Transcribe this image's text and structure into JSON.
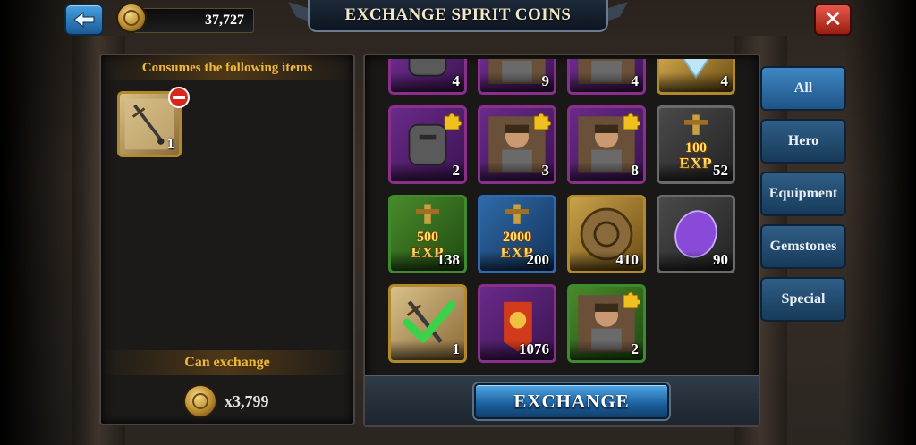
{
  "header": {
    "title": "EXCHANGE SPIRIT COINS",
    "coin_balance": "37,727"
  },
  "left_panel": {
    "consume_title": "Consumes the following items",
    "consume_item": {
      "icon": "sword-scroll-icon",
      "count": "1"
    },
    "can_exchange_label": "Can exchange",
    "can_exchange_amount": "x3,799"
  },
  "grid": {
    "rows": [
      [
        {
          "icon": "armor-fragment-icon",
          "count": "4",
          "frame": "purple"
        },
        {
          "icon": "hero-fragment-icon",
          "count": "9",
          "frame": "purple"
        },
        {
          "icon": "hero-fragment-icon",
          "count": "4",
          "frame": "purple"
        },
        {
          "icon": "diamond-icon",
          "count": "4",
          "frame": "gold"
        }
      ],
      [
        {
          "icon": "armor-fragment-icon",
          "count": "2",
          "frame": "purple"
        },
        {
          "icon": "hero-fragment-icon",
          "count": "3",
          "frame": "purple"
        },
        {
          "icon": "hero-fragment-icon",
          "count": "8",
          "frame": "purple"
        },
        {
          "icon": "exp-scroll-icon",
          "count": "52",
          "frame": "gray",
          "exp": "100",
          "exp_text": "EXP"
        }
      ],
      [
        {
          "icon": "exp-scroll-icon",
          "count": "138",
          "frame": "green",
          "exp": "500",
          "exp_text": "EXP"
        },
        {
          "icon": "exp-scroll-icon",
          "count": "200",
          "frame": "blue",
          "exp": "2000",
          "exp_text": "EXP"
        },
        {
          "icon": "shield-medallion-icon",
          "count": "410",
          "frame": "gold"
        },
        {
          "icon": "purple-gem-icon",
          "count": "90",
          "frame": "gray"
        }
      ],
      [
        {
          "icon": "sword-scroll-icon",
          "count": "1",
          "frame": "parch",
          "selected": true
        },
        {
          "icon": "banner-icon",
          "count": "1076",
          "frame": "purple"
        },
        {
          "icon": "hero-fragment-icon",
          "count": "2",
          "frame": "green"
        }
      ]
    ]
  },
  "exchange_button": "EXCHANGE",
  "tabs": [
    {
      "label": "All",
      "active": true
    },
    {
      "label": "Hero"
    },
    {
      "label": "Equipment"
    },
    {
      "label": "Gemstones"
    },
    {
      "label": "Special"
    }
  ]
}
